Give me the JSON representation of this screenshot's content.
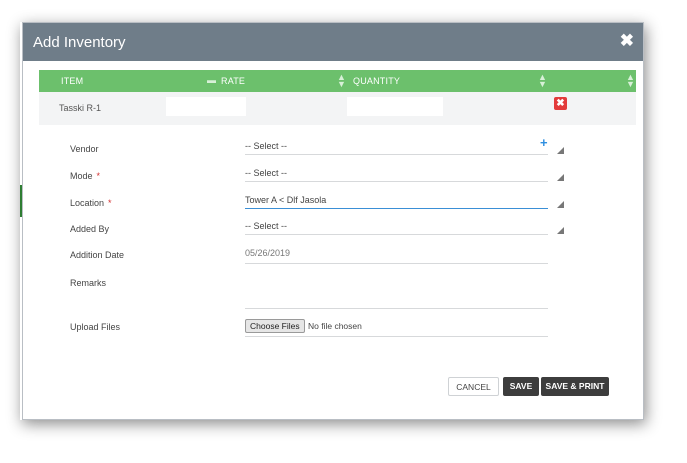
{
  "dialog": {
    "title": "Add Inventory",
    "close_icon": "close-icon"
  },
  "grid": {
    "columns": [
      "ITEM",
      "RATE",
      "QUANTITY"
    ],
    "rows": [
      {
        "item": "Tasski R-1"
      }
    ]
  },
  "form": {
    "vendor": {
      "label": "Vendor",
      "value": "-- Select --"
    },
    "mode": {
      "label": "Mode",
      "required_mark": "*",
      "value": "-- Select --"
    },
    "location": {
      "label": "Location",
      "required_mark": "*",
      "value": "Tower A < Dlf Jasola"
    },
    "added_by": {
      "label": "Added By",
      "value": "-- Select --"
    },
    "addition_date": {
      "label": "Addition Date",
      "value": "05/26/2019"
    },
    "remarks": {
      "label": "Remarks",
      "value": ""
    },
    "upload": {
      "label": "Upload Files",
      "button": "Choose Files",
      "status": "No file chosen"
    }
  },
  "actions": {
    "cancel": "CANCEL",
    "save": "SAVE",
    "save_print": "SAVE & PRINT"
  },
  "colors": {
    "header_bg": "#6f7d89",
    "grid_header_bg": "#6cc06c",
    "delete_red": "#e33b3b",
    "focus_blue": "#3a8fd6"
  }
}
